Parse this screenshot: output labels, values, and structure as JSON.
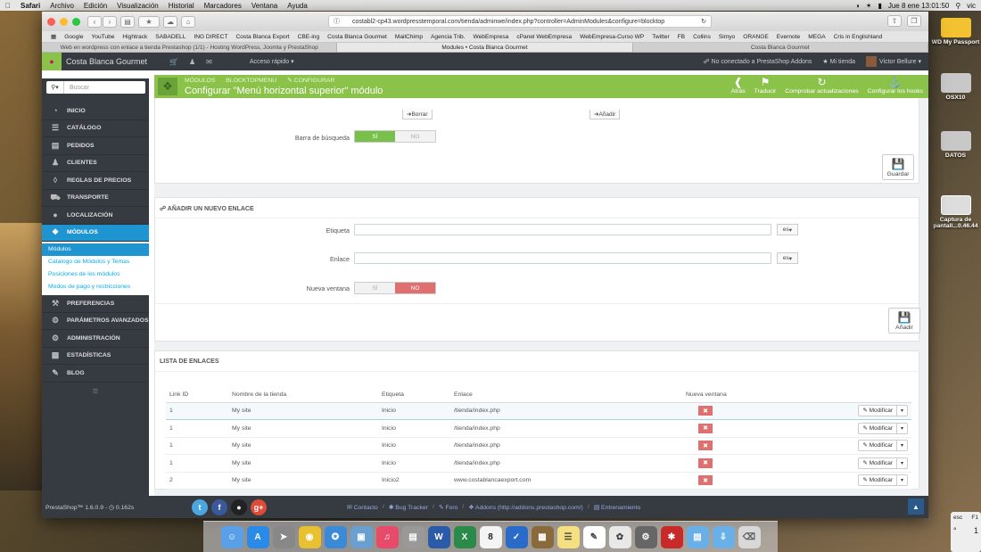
{
  "macos": {
    "menubar": {
      "apple": "",
      "app": "Safari",
      "items": [
        "Archivo",
        "Edición",
        "Visualización",
        "Historial",
        "Marcadores",
        "Ventana",
        "Ayuda"
      ],
      "user": "vic",
      "datetime": "Jue 8 ene  13:01:50"
    },
    "desktop_icons": [
      {
        "label": "WD My Passport"
      },
      {
        "label": "OSX10"
      },
      {
        "label": "DATOS"
      },
      {
        "label": "Captura de pantall...0.46.44"
      }
    ],
    "keyboard": {
      "esc": "esc",
      "f1": "F1",
      "one": "1",
      "sym": "°"
    },
    "dock": [
      "Finder",
      "App Store",
      "Launchpad",
      "Chrome",
      "Safari",
      "Preview",
      "iTunes",
      "Scanner",
      "Word",
      "Excel",
      "Calendar",
      "Pages",
      "Notes",
      "TextEdit",
      "Photos",
      "System Preferences",
      "Acrobat",
      "Folder",
      "Downloads",
      "Trash"
    ],
    "calendar_day": "8"
  },
  "browser": {
    "url": "costabl2-cp43.wordpresstemporal.com/tienda/adminwe/index.php?controller=AdminModules&configure=blocktop",
    "bookmarks": [
      "Google",
      "YouTube",
      "Hightrack",
      "SABADELL",
      "ING DIRECT",
      "Costa Blanca Export",
      "CBE-ing",
      "Costa Blanca Gourmet",
      "MailChimp",
      "Agencia Trib.",
      "WebEmpresa",
      "cPanel WebEmpresa",
      "WebEmpresa-Curso WP",
      "Twitter",
      "FB",
      "Collins",
      "Simyo",
      "ORANGE",
      "Evernote",
      "MEGA",
      "Cris in Englishland"
    ],
    "tabs": [
      {
        "label": "Web en wordpress con enlace a tienda Prestashop (1/1) - Hosting WordPress, Joomla y PrestaShop",
        "active": false
      },
      {
        "label": "Modules • Costa Blanca Gourmet",
        "active": true
      },
      {
        "label": "Costa Blanca Gourmet",
        "active": false
      }
    ]
  },
  "header": {
    "shop_name": "Costa Blanca Gourmet",
    "quick_access": "Acceso rápido",
    "addons": "No conectado a PrestaShop Addons",
    "my_shop": "Mi tienda",
    "user": "Victor Bellure"
  },
  "sidebar": {
    "search_placeholder": "Buscar",
    "items": [
      {
        "label": "Inicio",
        "icon": "dashboard-icon"
      },
      {
        "label": "Catálogo",
        "icon": "catalog-icon"
      },
      {
        "label": "Pedidos",
        "icon": "orders-icon"
      },
      {
        "label": "Clientes",
        "icon": "customers-icon"
      },
      {
        "label": "Reglas de precios",
        "icon": "price-rules-icon"
      },
      {
        "label": "Transporte",
        "icon": "truck-icon"
      },
      {
        "label": "Localización",
        "icon": "globe-icon"
      },
      {
        "label": "Módulos",
        "icon": "puzzle-icon"
      }
    ],
    "submenu": [
      "Módulos",
      "Catalogo de Módulos y Temas",
      "Posiciones de los módulos",
      "Modos de pago y restricciones"
    ],
    "items2": [
      {
        "label": "Preferencias",
        "icon": "wrench-icon"
      },
      {
        "label": "Parámetros avanzados",
        "icon": "cogs-icon"
      },
      {
        "label": "Administración",
        "icon": "gear-icon"
      },
      {
        "label": "Estadísticas",
        "icon": "stats-icon"
      },
      {
        "label": "Blog",
        "icon": "pencil-icon"
      }
    ]
  },
  "toolbar": {
    "breadcrumbs": [
      "Módulos",
      "blocktopmenu",
      "Configurar"
    ],
    "title": "Configurar \"Menú horizontal superior\" módulo",
    "actions": [
      "Atrás",
      "Traducir",
      "Comprobar actualizaciones",
      "Configurar los hooks"
    ]
  },
  "panel1": {
    "borrar": "Borrar",
    "anadir": "Añadir",
    "search_bar_label": "Barra de búsqueda",
    "yes": "SÍ",
    "no": "NO",
    "save": "Guardar"
  },
  "panel2": {
    "heading": "Añadir un nuevo enlace",
    "label_label": "Etiqueta",
    "link_label": "Enlace",
    "new_window_label": "Nueva ventana",
    "lang": "es",
    "yes": "SÍ",
    "no": "NO",
    "add": "Añadir"
  },
  "panel3": {
    "heading": "Lista de enlaces",
    "columns": [
      "Link ID",
      "Nombre de la tienda",
      "Etiqueta",
      "Enlace",
      "Nueva ventana"
    ],
    "rows": [
      {
        "id": "1",
        "shop": "My site",
        "label": "Inicio",
        "link": "/tienda/index.php"
      },
      {
        "id": "1",
        "shop": "My site",
        "label": "Inicio",
        "link": "/tienda/index.php"
      },
      {
        "id": "1",
        "shop": "My site",
        "label": "Inicio",
        "link": "/tienda/index.php"
      },
      {
        "id": "1",
        "shop": "My site",
        "label": "Inicio",
        "link": "/tienda/index.php"
      },
      {
        "id": "2",
        "shop": "My site",
        "label": "Inicio2",
        "link": "www.costablancaexport.com"
      }
    ],
    "modify": "Modificar"
  },
  "footer": {
    "version": "PrestaShop™ 1.6.0.9 - ",
    "time": "0.162s",
    "links": [
      "Contacto",
      "Bug Tracker",
      "Foro",
      "Addons (http://addons.prestashop.com/)",
      "Entrenamiento"
    ]
  },
  "colors": {
    "green": "#8bc34a",
    "dark": "#363a41",
    "blue": "#1e94d0",
    "red": "#e07070"
  }
}
